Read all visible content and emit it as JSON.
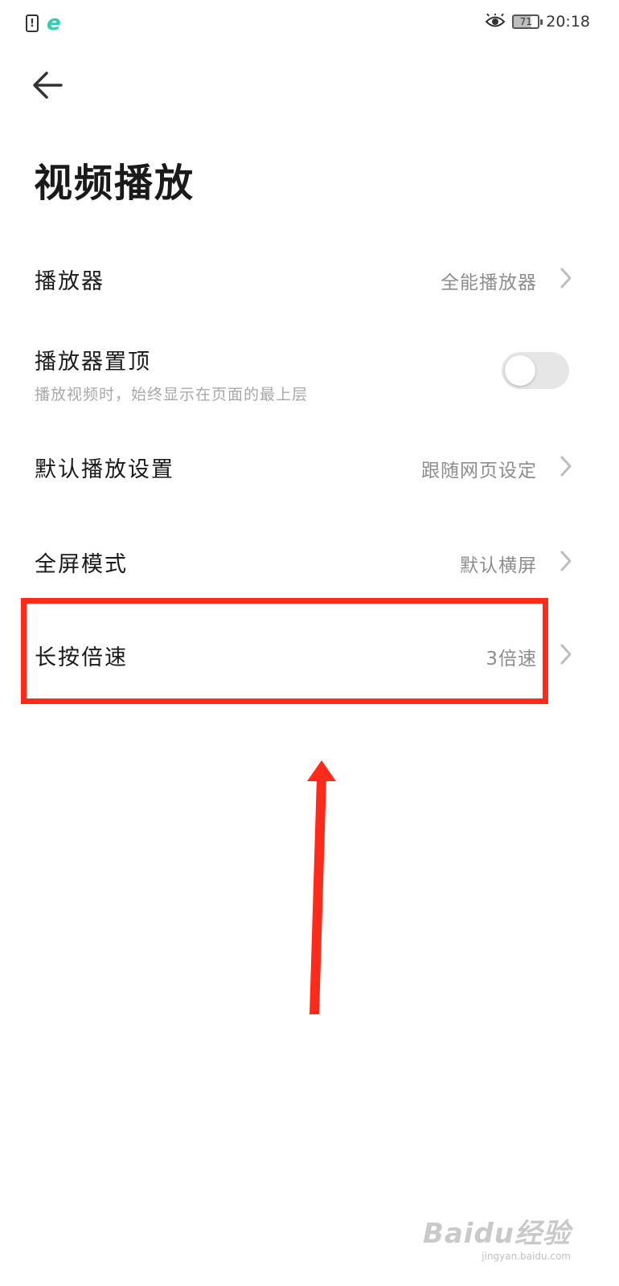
{
  "status_bar": {
    "sim_glyph": "!",
    "app_glyph": "e",
    "battery_level": "71",
    "time": "20:18"
  },
  "page": {
    "title": "视频播放"
  },
  "settings": {
    "player": {
      "label": "播放器",
      "value": "全能播放器"
    },
    "pin_player": {
      "label": "播放器置顶",
      "description": "播放视频时，始终显示在页面的最上层",
      "enabled": false
    },
    "default_playback": {
      "label": "默认播放设置",
      "value": "跟随网页设定"
    },
    "fullscreen_mode": {
      "label": "全屏模式",
      "value": "默认横屏"
    },
    "long_press_speed": {
      "label": "长按倍速",
      "value": "3倍速"
    }
  },
  "annotation": {
    "color": "#ff2a1a"
  },
  "watermark": {
    "main": "Baidu经验",
    "sub": "jingyan.baidu.com"
  }
}
